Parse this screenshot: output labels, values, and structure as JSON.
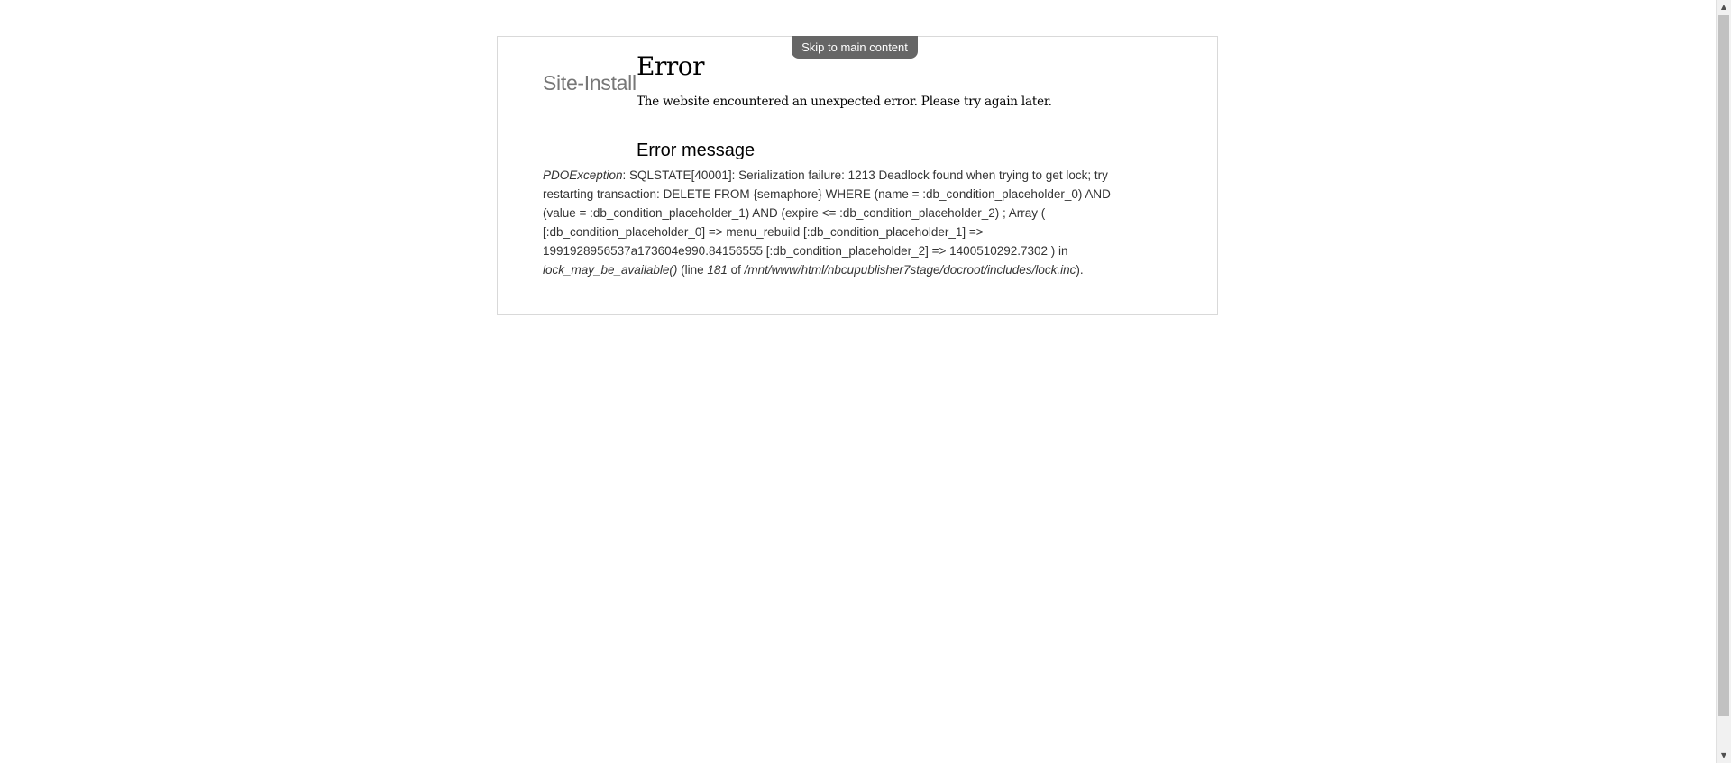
{
  "skip_link": "Skip to main content",
  "site_name": "Site-Install",
  "page": {
    "title": "Error",
    "intro": "The website encountered an unexpected error. Please try again later."
  },
  "error": {
    "heading": "Error message",
    "exception_type": "PDOException",
    "message": ": SQLSTATE[40001]: Serialization failure: 1213 Deadlock found when trying to get lock; try restarting transaction: DELETE FROM {semaphore} WHERE (name = :db_condition_placeholder_0) AND (value = :db_condition_placeholder_1) AND (expire <= :db_condition_placeholder_2) ; Array ( [:db_condition_placeholder_0] => menu_rebuild [:db_condition_placeholder_1] => 1991928956537a173604e990.84156555 [:db_condition_placeholder_2] => 1400510292.7302 ) in ",
    "function": "lock_may_be_available()",
    "line_prefix": " (line ",
    "line_number": "181",
    "of_text": " of ",
    "file_path": "/mnt/www/html/nbcupublisher7stage/docroot/includes/lock.inc",
    "suffix": ")."
  },
  "scrollbar": {
    "up_arrow_icon": "triangle-up",
    "down_arrow_icon": "triangle-down"
  }
}
